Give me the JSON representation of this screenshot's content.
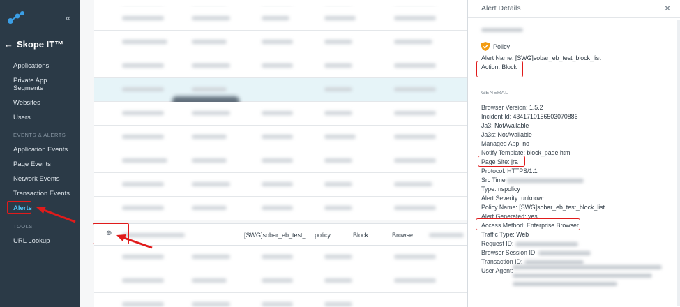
{
  "sidebar": {
    "collapse_glyph": "«",
    "brand": "Skope IT™",
    "back_glyph": "←",
    "items": [
      {
        "label": "Applications"
      },
      {
        "label": "Private App Segments"
      },
      {
        "label": "Websites"
      },
      {
        "label": "Users"
      }
    ],
    "events_section": "EVENTS & ALERTS",
    "event_items": [
      {
        "label": "Application Events"
      },
      {
        "label": "Page Events"
      },
      {
        "label": "Network Events"
      },
      {
        "label": "Transaction Events"
      },
      {
        "label": "Alerts"
      }
    ],
    "tools_section": "TOOLS",
    "tool_items": [
      {
        "label": "URL Lookup"
      }
    ]
  },
  "table": {
    "selected_row": {
      "zoom_glyph": "⊕",
      "policy": "[SWG]sobar_eb_test_...",
      "type": "policy",
      "action": "Block",
      "category": "Browse"
    }
  },
  "panel": {
    "title": "Alert Details",
    "close_glyph": "✕",
    "policy_label": "Policy",
    "alert_name_key": "Alert Name:",
    "alert_name_value": "[SWG]sobar_eb_test_block_list",
    "action_key": "Action:",
    "action_value": "Block",
    "general_section": "GENERAL",
    "fields": [
      {
        "k": "Browser Version:",
        "v": "1.5.2"
      },
      {
        "k": "Incident Id:",
        "v": "4341710156503070886"
      },
      {
        "k": "Ja3:",
        "v": "NotAvailable"
      },
      {
        "k": "Ja3s:",
        "v": "NotAvailable"
      },
      {
        "k": "Managed App:",
        "v": "no"
      },
      {
        "k": "Notify Template:",
        "v": "block_page.html"
      },
      {
        "k": "Page Site:",
        "v": "jra"
      },
      {
        "k": "Protocol:",
        "v": "HTTPS/1.1"
      },
      {
        "k": "Src Time",
        "v": ""
      },
      {
        "k": "Type:",
        "v": "nspolicy"
      },
      {
        "k": "Alert Severity:",
        "v": "unknown"
      },
      {
        "k": "Policy Name:",
        "v": "[SWG]sobar_eb_test_block_list"
      },
      {
        "k": "Alert Generated:",
        "v": "yes"
      },
      {
        "k": "Access Method:",
        "v": "Enterprise Browser"
      },
      {
        "k": "Traffic Type:",
        "v": "Web"
      },
      {
        "k": "Request ID:",
        "v": ""
      },
      {
        "k": "Browser Session ID:",
        "v": ""
      },
      {
        "k": "Transaction ID:",
        "v": ""
      },
      {
        "k": "User Agent:",
        "v": ""
      }
    ]
  },
  "colors": {
    "sidebar_bg": "#2b3a47",
    "active_link": "#4fc3f7",
    "annotation_red": "#e01b1b",
    "shield_orange": "#f39c12"
  }
}
